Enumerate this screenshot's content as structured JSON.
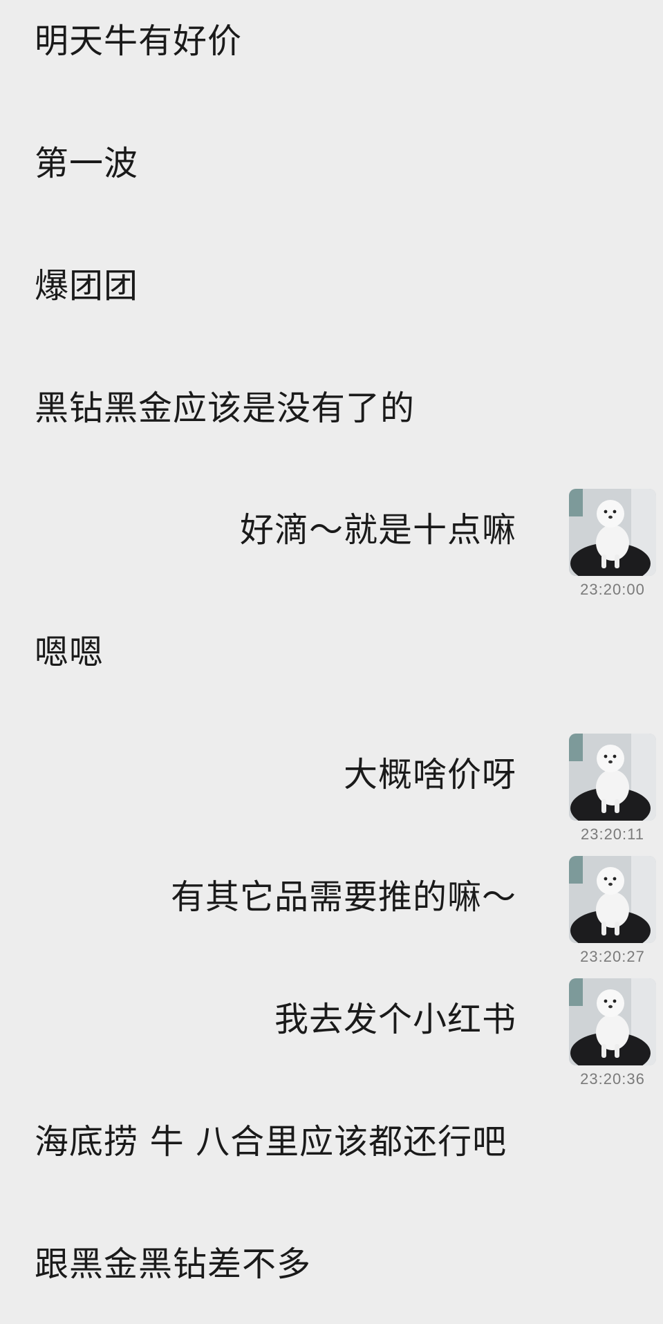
{
  "messages": [
    {
      "side": "left",
      "text": "明天牛有好价"
    },
    {
      "side": "left",
      "text": "第一波"
    },
    {
      "side": "left",
      "text": "爆团团"
    },
    {
      "side": "left",
      "text": "黑钻黑金应该是没有了的"
    },
    {
      "side": "right",
      "text": "好滴～就是十点嘛",
      "time": "23:20:00",
      "avatar_icon": "white-dog-photo-avatar"
    },
    {
      "side": "left",
      "text": "嗯嗯"
    },
    {
      "side": "right",
      "text": "大概啥价呀",
      "time": "23:20:11",
      "avatar_icon": "white-dog-photo-avatar"
    },
    {
      "side": "right",
      "text": "有其它品需要推的嘛～",
      "time": "23:20:27",
      "avatar_icon": "white-dog-photo-avatar"
    },
    {
      "side": "right",
      "text": "我去发个小红书",
      "time": "23:20:36",
      "avatar_icon": "white-dog-photo-avatar"
    },
    {
      "side": "left",
      "text": "海底捞 牛 八合里应该都还行吧"
    },
    {
      "side": "left",
      "text": "跟黑金黑钻差不多"
    }
  ],
  "colors": {
    "background": "#ededed",
    "text": "#1a1a1a",
    "timestamp": "#7a7a7a"
  }
}
